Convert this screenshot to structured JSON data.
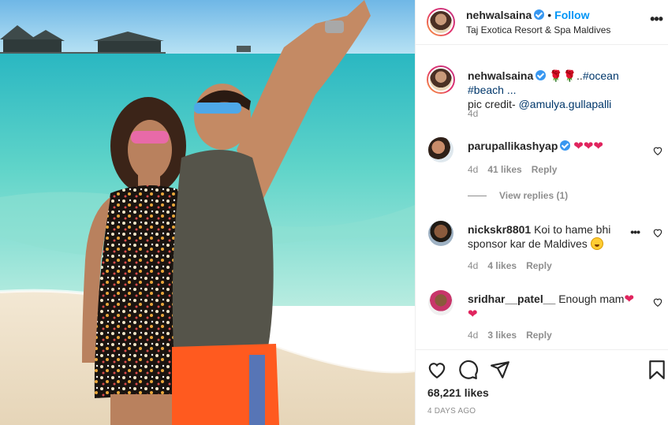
{
  "post": {
    "author": "nehwalsaina",
    "follow_label": "Follow",
    "dot": "•",
    "location": "Taj Exotica Resort & Spa Maldives",
    "more_icon": "•••",
    "caption": {
      "username": "nehwalsaina",
      "roses": "🌹🌹",
      "text_dots": "..",
      "hashtags": "#ocean #beach ...",
      "line2_prefix": "pic credit- ",
      "mention": "@amulya.gullapalli",
      "age": "4d"
    },
    "comments": [
      {
        "username": "parupallikashyap",
        "text": "",
        "hearts": "❤❤❤",
        "age": "4d",
        "likes": "41 likes",
        "reply": "Reply",
        "verified": true
      },
      {
        "username": "nickskr8801",
        "text": "Koi to hame bhi sponsor kar de Maldives",
        "age": "4d",
        "likes": "4 likes",
        "reply": "Reply"
      },
      {
        "username": "sridhar__patel__",
        "text": "Enough mam",
        "hearts": "❤",
        "hearts2": "❤",
        "age": "4d",
        "likes": "3 likes",
        "reply": "Reply"
      }
    ],
    "view_replies": "View replies (1)",
    "likes_count": "68,221 likes",
    "posted_ago": "4 DAYS AGO"
  },
  "colors": {
    "link": "#0095f6",
    "ocean": "#3cc4c4",
    "sky": "#8fd0ef",
    "sand": "#efe2cc",
    "heart": "#e0245e"
  }
}
